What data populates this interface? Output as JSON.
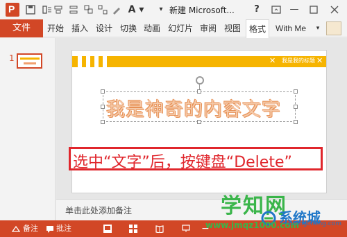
{
  "window": {
    "title": "新建 Microsoft...",
    "help_label": "?",
    "min_label": "—"
  },
  "ribbon": {
    "file_tab": "文件",
    "tabs": [
      "开始",
      "插入",
      "设计",
      "切换",
      "动画",
      "幻灯片",
      "审阅",
      "视图",
      "格式"
    ],
    "active_tab": "格式",
    "user": "With Me"
  },
  "thumbnails": {
    "slide_number": "1"
  },
  "slide": {
    "band_text": "我是我的标题",
    "main_text": "我是神奇的内容文字"
  },
  "annotation": {
    "text": "选中“文字”后，按键盘“Delete”"
  },
  "notes": {
    "placeholder": "单击此处添加备注"
  },
  "statusbar": {
    "notes_label": "备注",
    "comments_label": "批注"
  },
  "watermark": {
    "brand": "学知网",
    "url": "www.jmqz1000.com",
    "brand2": "系统城",
    "url2": "xitongcheng.com"
  },
  "colors": {
    "accent": "#d24726",
    "band": "#f6b400",
    "callout": "#e0262c"
  }
}
